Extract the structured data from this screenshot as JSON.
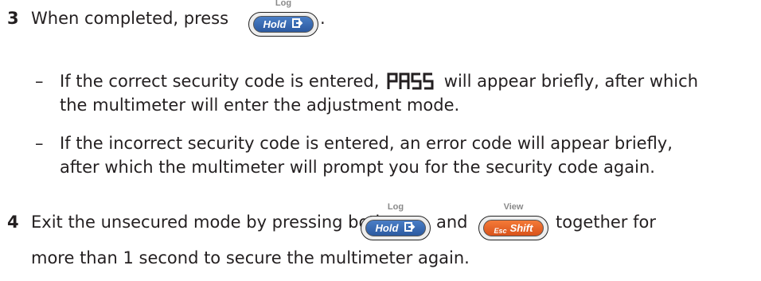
{
  "step3": {
    "number": "3",
    "text": "When completed, press",
    "period": ".",
    "bullets": [
      {
        "dash": "–",
        "line1_before": "If the correct security code is entered,",
        "pass_display": "PASS",
        "line1_after": "will appear briefly, after which",
        "line2": "the multimeter will enter the adjustment mode."
      },
      {
        "dash": "–",
        "line1": "If the incorrect security code is entered, an error code will appear briefly,",
        "line2": "after which the multimeter will prompt you for the security code again."
      }
    ]
  },
  "step4": {
    "number": "4",
    "text_before": "Exit the unsecured mode by pressing both",
    "text_and": "and",
    "text_after": "together for",
    "line2": "more than 1 second to secure the multimeter again."
  },
  "keys": {
    "hold": {
      "label": "Hold",
      "shift_label": "Log",
      "icon": "log-arrow-icon",
      "color": "#3a6bb5"
    },
    "shift": {
      "label": "Shift",
      "esc_label": "Esc",
      "shift_label": "View",
      "color": "#e8642a"
    }
  }
}
